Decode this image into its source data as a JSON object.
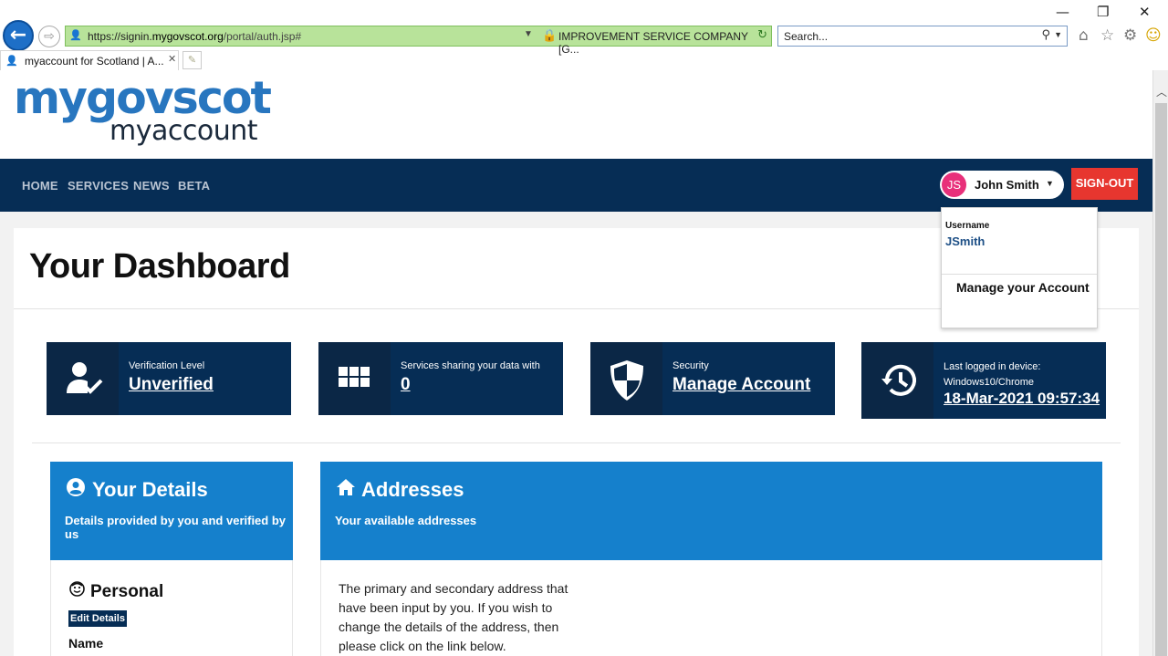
{
  "browser": {
    "url_prefix": "https://signin.",
    "url_domain": "mygovscot.org",
    "url_path": "/portal/auth.jsp#",
    "cert_name": "IMPROVEMENT SERVICE COMPANY [G...",
    "search_placeholder": "Search...",
    "tab_title": "myaccount for Scotland | A...",
    "win_minimize": "—",
    "win_restore": "❐",
    "win_close": "✕",
    "icons": [
      "back-arrow-icon",
      "forward-arrow-icon",
      "lock-icon",
      "refresh-icon",
      "search-icon",
      "home-icon",
      "star-icon",
      "gear-icon",
      "smiley-icon"
    ],
    "address_bar_color": "#b8e39a"
  },
  "logo": {
    "main": "mygovscot",
    "sub": "myaccount",
    "color_main": "#2876bf",
    "color_sub": "#1b2a3c"
  },
  "nav": {
    "items": [
      "HOME",
      "SERVICES",
      "NEWS",
      "BETA"
    ],
    "user_initials": "JS",
    "user_name": "John Smith",
    "signout": "SIGN-OUT",
    "bg_color": "#062d55",
    "signout_color": "#e7362f"
  },
  "dropdown": {
    "username_label": "Username",
    "username": "JSmith",
    "manage": "Manage your Account"
  },
  "dashboard": {
    "title": "Your Dashboard",
    "stats": [
      {
        "label": "Verification Level",
        "value": "Unverified",
        "icon": "user-check-icon"
      },
      {
        "label": "Services sharing your data with",
        "value": "0",
        "icon": "grid-icon"
      },
      {
        "label": "Security",
        "value": "Manage Account",
        "icon": "shield-icon"
      },
      {
        "label": "Last logged in device:",
        "label2": "Windows10/Chrome",
        "value": "18-Mar-2021 09:57:34",
        "icon": "history-icon"
      }
    ]
  },
  "details": {
    "title": "Your Details",
    "subtitle": "Details provided by you and verified by us",
    "personal_title": "Personal",
    "edit_button": "Edit Details",
    "name_label": "Name"
  },
  "addresses": {
    "title": "Addresses",
    "subtitle": "Your available addresses",
    "description": "The primary and secondary address that have been input by you. If you wish to change the details of the address, then please click on the link below."
  }
}
